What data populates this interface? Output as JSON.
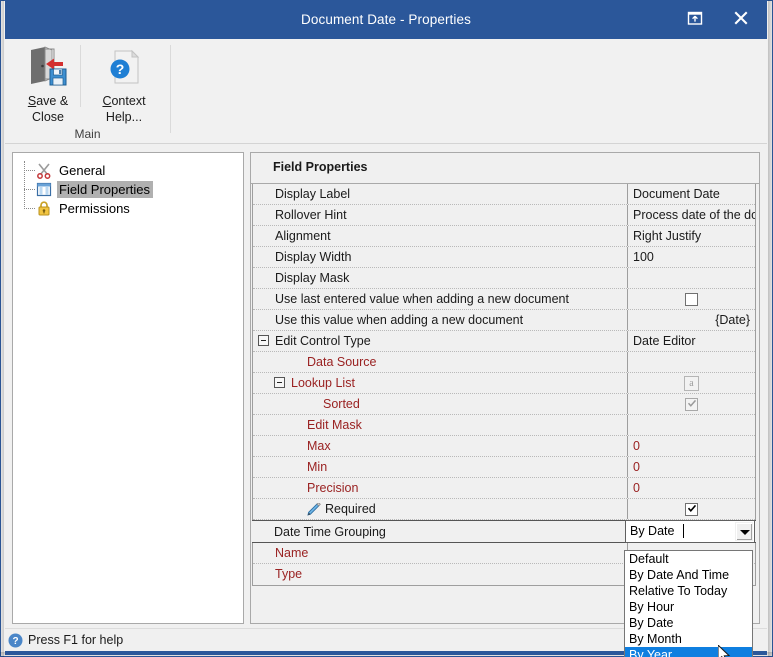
{
  "window": {
    "title": "Document Date - Properties",
    "restore_icon": "restore-window-icon",
    "close_icon": "close-icon",
    "titlebar_color": "#2b579a"
  },
  "ribbon": {
    "group_title": "Main",
    "buttons": [
      {
        "id": "save-close",
        "icon": "save-and-close-icon",
        "line1_pre": "S",
        "line1_post": "ave &",
        "line2": "Close"
      },
      {
        "id": "context-help",
        "icon": "context-help-icon",
        "line1_pre": "C",
        "line1_post": "ontext",
        "line2": "Help..."
      }
    ]
  },
  "tree": {
    "items": [
      {
        "label": "General",
        "icon": "scissors-icon",
        "selected": false
      },
      {
        "label": "Field Properties",
        "icon": "table-grid-icon",
        "selected": true
      },
      {
        "label": "Permissions",
        "icon": "lock-icon",
        "selected": false
      }
    ]
  },
  "grid": {
    "header": "Field Properties",
    "rows": [
      {
        "name": "Display Label",
        "value": "Document Date",
        "indent": 0,
        "color": "dark",
        "type": "text"
      },
      {
        "name": "Rollover Hint",
        "value": "Process date of the doc",
        "indent": 0,
        "color": "dark",
        "type": "text"
      },
      {
        "name": "Alignment",
        "value": "Right Justify",
        "indent": 0,
        "color": "dark",
        "type": "text"
      },
      {
        "name": "Display Width",
        "value": "100",
        "indent": 0,
        "color": "dark",
        "type": "text"
      },
      {
        "name": "Display Mask",
        "value": "",
        "indent": 0,
        "color": "dark",
        "type": "text"
      },
      {
        "name": "Use last entered value when adding a new document",
        "value": "",
        "indent": 0,
        "color": "dark",
        "type": "checkbox",
        "checked": false,
        "disabled": false
      },
      {
        "name": "Use this value when adding a new document",
        "value": "{Date}",
        "indent": 0,
        "color": "dark",
        "type": "text-right"
      },
      {
        "name": "Edit Control Type",
        "value": "Date Editor",
        "indent": 0,
        "color": "dark",
        "type": "text",
        "expander": true,
        "expander_level": 0
      },
      {
        "name": "Data Source",
        "value": "",
        "indent": 1,
        "color": "red",
        "type": "text"
      },
      {
        "name": "Lookup List",
        "value": "a",
        "indent": 1,
        "color": "red",
        "type": "abutton",
        "expander": true,
        "expander_level": 1
      },
      {
        "name": "Sorted",
        "value": "",
        "indent": 2,
        "color": "red",
        "type": "checkbox",
        "checked": true,
        "disabled": true
      },
      {
        "name": "Edit Mask",
        "value": "",
        "indent": 1,
        "color": "red",
        "type": "text"
      },
      {
        "name": "Max",
        "value": "0",
        "indent": 1,
        "color": "red",
        "type": "text"
      },
      {
        "name": "Min",
        "value": "0",
        "indent": 1,
        "color": "red",
        "type": "text"
      },
      {
        "name": "Precision",
        "value": "0",
        "indent": 1,
        "color": "red",
        "type": "text"
      },
      {
        "name": "Required",
        "value": "",
        "indent": 1,
        "color": "dark",
        "type": "checkbox",
        "checked": true,
        "disabled": false,
        "icon": "pencil-icon"
      }
    ],
    "editing_row": {
      "name": "Date Time Grouping",
      "value": "By Date"
    },
    "rows_after": [
      {
        "name": "Name",
        "value": "",
        "indent": 0,
        "color": "red",
        "type": "text"
      },
      {
        "name": "Type",
        "value": "",
        "indent": 0,
        "color": "red",
        "type": "text"
      }
    ]
  },
  "dropdown": {
    "options": [
      "Default",
      "By Date And Time",
      "Relative To Today",
      "By Hour",
      "By Date",
      "By Month",
      "By Year"
    ],
    "selected": "By Year",
    "highlight_color": "#0f7fe0"
  },
  "statusbar": {
    "icon": "help-circle-icon",
    "text": "Press F1 for help"
  }
}
